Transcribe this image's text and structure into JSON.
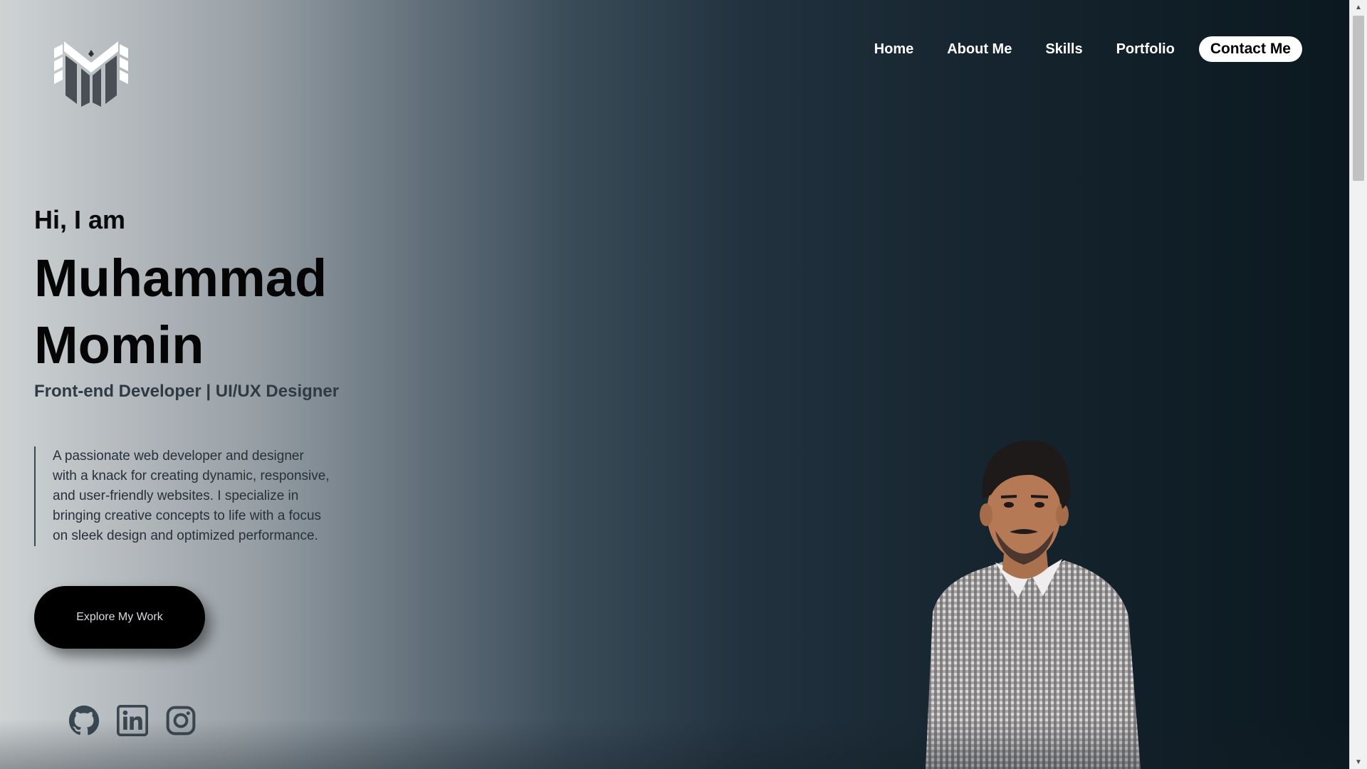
{
  "nav": {
    "items": [
      {
        "label": "Home"
      },
      {
        "label": "About Me"
      },
      {
        "label": "Skills"
      },
      {
        "label": "Portfolio"
      }
    ],
    "contact_label": "Contact Me"
  },
  "hero": {
    "greeting": "Hi, I am",
    "name_line1": "Muhammad",
    "name_line2": "Momin",
    "role": "Front-end Developer | UI/UX Designer",
    "bio_lines": [
      "A passionate web developer and designer",
      "with a knack for creating dynamic, responsive,",
      "and user-friendly websites. I specialize in",
      "bringing creative concepts to life with a focus",
      "on sleek design and optimized performance."
    ],
    "cta_label": "Explore My Work"
  },
  "socials": [
    {
      "icon": "github-icon"
    },
    {
      "icon": "linkedin-icon"
    },
    {
      "icon": "instagram-icon"
    }
  ],
  "colors": {
    "gradient_left": "#cfd3d4",
    "gradient_right": "#0b1820",
    "nav_text": "#ffffff",
    "cta_bg": "#000000"
  }
}
